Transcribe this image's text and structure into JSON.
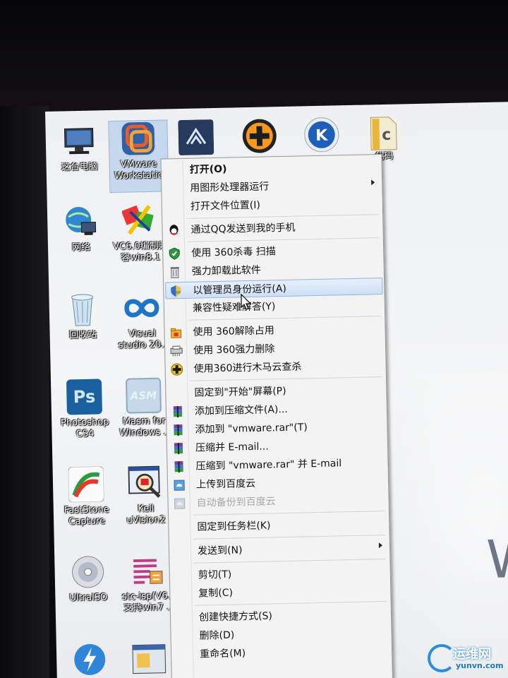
{
  "desktop": {
    "icons": [
      {
        "label": "这台电脑",
        "icon": "computer-icon"
      },
      {
        "label": "VMware Workstation",
        "line1": "VMware",
        "line2": "Workstatio",
        "icon": "vmware-icon"
      },
      {
        "label": "网络",
        "icon": "network-icon"
      },
      {
        "label": "VC6.0编制兼容win8.1",
        "line1": "VC6.0编制兼",
        "line2": "容win8.1",
        "icon": "vc6-icon"
      },
      {
        "label": "回收站",
        "icon": "recycle-bin-icon"
      },
      {
        "label": "Visual studio 20..",
        "line1": "Visual",
        "line2": "studio 20..",
        "icon": "visual-studio-icon"
      },
      {
        "label": "Photoshop CS4",
        "line1": "Photoshop",
        "line2": "CS4",
        "icon": "photoshop-icon"
      },
      {
        "label": "Masm for Windows",
        "line1": "Masm for",
        "line2": "Windows ..",
        "icon": "masm-icon"
      },
      {
        "label": "FastStone Capture",
        "line1": "FastStone",
        "line2": "Capture",
        "icon": "faststone-icon"
      },
      {
        "label": "Keil uVision2",
        "line1": "Keil",
        "line2": "uVision2",
        "icon": "keil-icon"
      },
      {
        "label": "UltraISO",
        "icon": "ultraiso-icon"
      },
      {
        "label": "stc-isp(V6.. 支持win7 ..",
        "line1": "stc-isp(V6..",
        "line2": "支持win7 ..",
        "icon": "stc-isp-icon"
      }
    ],
    "top_row_partial_label": "代码",
    "psd_glyph": "Ps",
    "asm_glyph": "ASM",
    "k_glyph": "K",
    "big_letter": "W"
  },
  "context_menu": {
    "items": [
      {
        "label": "打开(O)",
        "bold": true
      },
      {
        "label": "用图形处理器运行",
        "submenu": true
      },
      {
        "label": "打开文件位置(I)"
      },
      {
        "label": "通过QQ发送到我的手机",
        "icon": "qq-icon"
      },
      {
        "label": "使用 360杀毒 扫描",
        "icon": "360-antivirus-icon"
      },
      {
        "label": "强力卸载此软件",
        "icon": "trash-icon"
      },
      {
        "label": "以管理员身份运行(A)",
        "icon": "uac-shield-icon",
        "highlighted": true
      },
      {
        "label": "兼容性疑难解答(Y)"
      },
      {
        "label": "使用 360解除占用",
        "icon": "360-unlock-icon"
      },
      {
        "label": "使用 360强力删除",
        "icon": "shredder-icon"
      },
      {
        "label": "使用360进行木马云查杀",
        "icon": "360-cloud-scan-icon"
      },
      {
        "label": "固定到\"开始\"屏幕(P)"
      },
      {
        "label": "添加到压缩文件(A)...",
        "icon": "winrar-icon"
      },
      {
        "label": "添加到 \"vmware.rar\"(T)",
        "icon": "winrar-icon"
      },
      {
        "label": "压缩并 E-mail...",
        "icon": "winrar-icon"
      },
      {
        "label": "压缩到 \"vmware.rar\" 并 E-mail",
        "icon": "winrar-icon"
      },
      {
        "label": "上传到百度云",
        "icon": "baidu-cloud-icon"
      },
      {
        "label": "自动备份到百度云",
        "icon": "baidu-cloud-icon",
        "disabled": true
      },
      {
        "label": "固定到任务栏(K)"
      },
      {
        "label": "发送到(N)",
        "submenu": true
      },
      {
        "label": "剪切(T)"
      },
      {
        "label": "复制(C)"
      },
      {
        "label": "创建快捷方式(S)"
      },
      {
        "label": "删除(D)"
      },
      {
        "label": "重命名(M)"
      }
    ]
  },
  "watermark": {
    "cn": "运维网",
    "en": "yunvn.com"
  },
  "colors": {
    "highlight": "#cfe0f5",
    "menu_bg": "#f3f3f3",
    "accent": "#2a8fd6"
  }
}
